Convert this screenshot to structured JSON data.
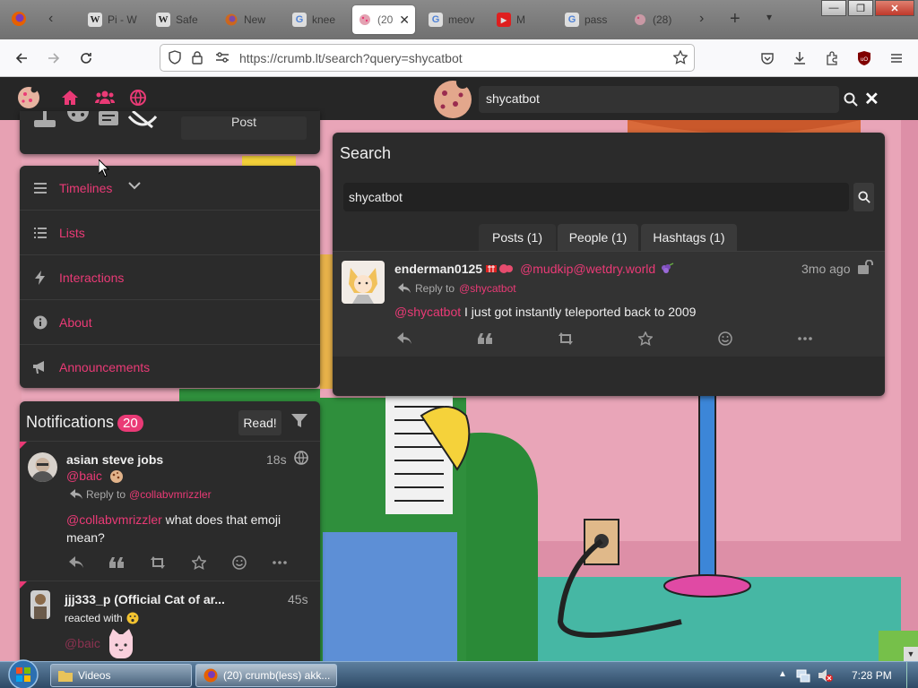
{
  "browser": {
    "tabs": [
      {
        "label": "Pi - W",
        "icon": "wikipedia-icon"
      },
      {
        "label": "Safe",
        "icon": "wikipedia-icon"
      },
      {
        "label": "New",
        "icon": "firefox-icon"
      },
      {
        "label": "knee",
        "icon": "google-icon"
      },
      {
        "label": "(20",
        "icon": "crumb-icon",
        "active": true
      },
      {
        "label": "meov",
        "icon": "google-icon"
      },
      {
        "label": "M",
        "icon": "youtube-icon"
      },
      {
        "label": "pass",
        "icon": "google-icon"
      },
      {
        "label": "(28)",
        "icon": "crumb-icon"
      }
    ],
    "url": "https://crumb.lt/search?query=shycatbot"
  },
  "header": {
    "search_value": "shycatbot"
  },
  "composer": {
    "post_label": "Post"
  },
  "menu": {
    "items": [
      {
        "label": "Timelines",
        "icon": "hamburger-icon"
      },
      {
        "label": "Lists",
        "icon": "list-icon"
      },
      {
        "label": "Interactions",
        "icon": "bolt-icon"
      },
      {
        "label": "About",
        "icon": "info-icon"
      },
      {
        "label": "Announcements",
        "icon": "megaphone-icon"
      }
    ]
  },
  "notifications": {
    "title": "Notifications",
    "count": "20",
    "read_label": "Read!",
    "items": [
      {
        "name": "asian steve jobs",
        "handle": "@baic",
        "time": "18s",
        "reply_label": "Reply to",
        "reply_to": "@collabvmrizzler",
        "mention": "@collabvmrizzler",
        "text": " what does that emoji mean?"
      },
      {
        "name": "jjj333_p (Official Cat of ar...",
        "time": "45s",
        "action": "reacted with",
        "handle": "@baic"
      }
    ]
  },
  "search": {
    "title": "Search",
    "query": "shycatbot",
    "tabs": [
      {
        "label": "Posts (1)",
        "active": true
      },
      {
        "label": "People (1)"
      },
      {
        "label": "Hashtags (1)"
      }
    ],
    "result": {
      "name": "enderman0125",
      "handle": "@mudkip@wetdry.world",
      "time": "3mo ago",
      "reply_label": "Reply to",
      "reply_to": "@shycatbot",
      "mention": "@shycatbot",
      "text": " I just got instantly teleported back to 2009"
    }
  },
  "taskbar": {
    "items": [
      {
        "label": "Videos"
      },
      {
        "label": "(20) crumb(less) akk..."
      }
    ],
    "clock": "7:28 PM"
  },
  "colors": {
    "accent": "#ea3a76",
    "panel": "#2b2b2b",
    "header": "#262626"
  }
}
